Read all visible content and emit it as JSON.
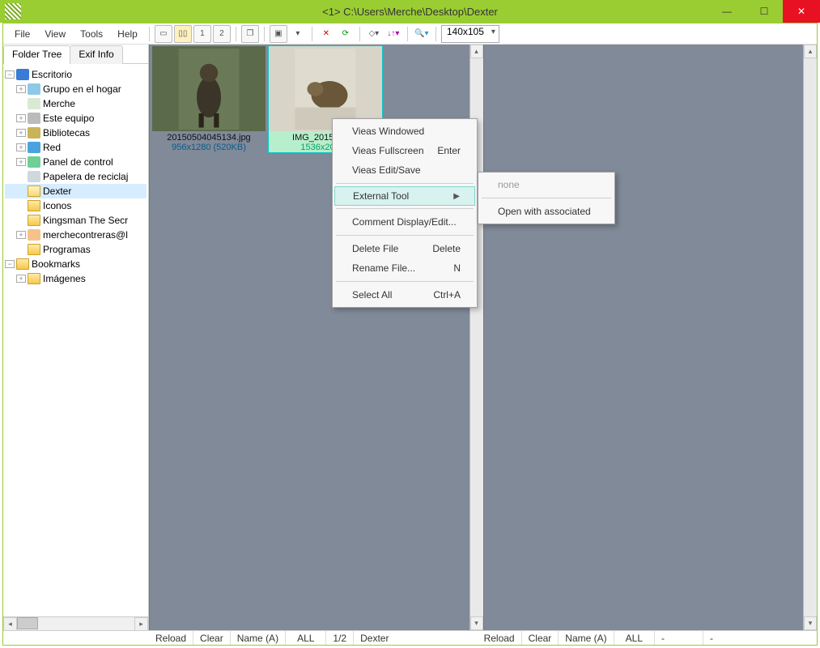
{
  "title": "<1> C:\\Users\\Merche\\Desktop\\Dexter",
  "menu": {
    "file": "File",
    "view": "View",
    "tools": "Tools",
    "help": "Help"
  },
  "toolbar": {
    "zoom": "140x105"
  },
  "tabs": {
    "folder": "Folder Tree",
    "exif": "Exif Info"
  },
  "tree": {
    "root": "Escritorio",
    "items": [
      "Grupo en el hogar",
      "Merche",
      "Este equipo",
      "Bibliotecas",
      "Red",
      "Panel de control",
      "Papelera de reciclaj",
      "Dexter",
      "Iconos",
      "Kingsman The Secr",
      "merchecontreras@l",
      "Programas"
    ],
    "bookmarks": "Bookmarks",
    "bmitems": [
      "Imágenes"
    ]
  },
  "thumbs": [
    {
      "file": "20150504045134.jpg",
      "dim": "956x1280 (520KB)"
    },
    {
      "file": "IMG_20150530_",
      "dim": "1536x2048 ("
    }
  ],
  "context": {
    "a": "Vieas Windowed",
    "b": "Vieas Fullscreen",
    "b_sc": "Enter",
    "c": "Vieas Edit/Save",
    "d": "External Tool",
    "e": "Comment Display/Edit...",
    "f": "Delete File",
    "f_sc": "Delete",
    "g": "Rename File...",
    "g_sc": "N",
    "h": "Select All",
    "h_sc": "Ctrl+A"
  },
  "submenu": {
    "a": "none",
    "b": "Open with associated"
  },
  "status": {
    "left": {
      "reload": "Reload",
      "clear": "Clear",
      "name": "Name (A)",
      "all": "ALL",
      "count": "1/2",
      "path": "Dexter"
    },
    "right": {
      "reload": "Reload",
      "clear": "Clear",
      "name": "Name (A)",
      "all": "ALL",
      "count": "-",
      "path": "-"
    }
  }
}
